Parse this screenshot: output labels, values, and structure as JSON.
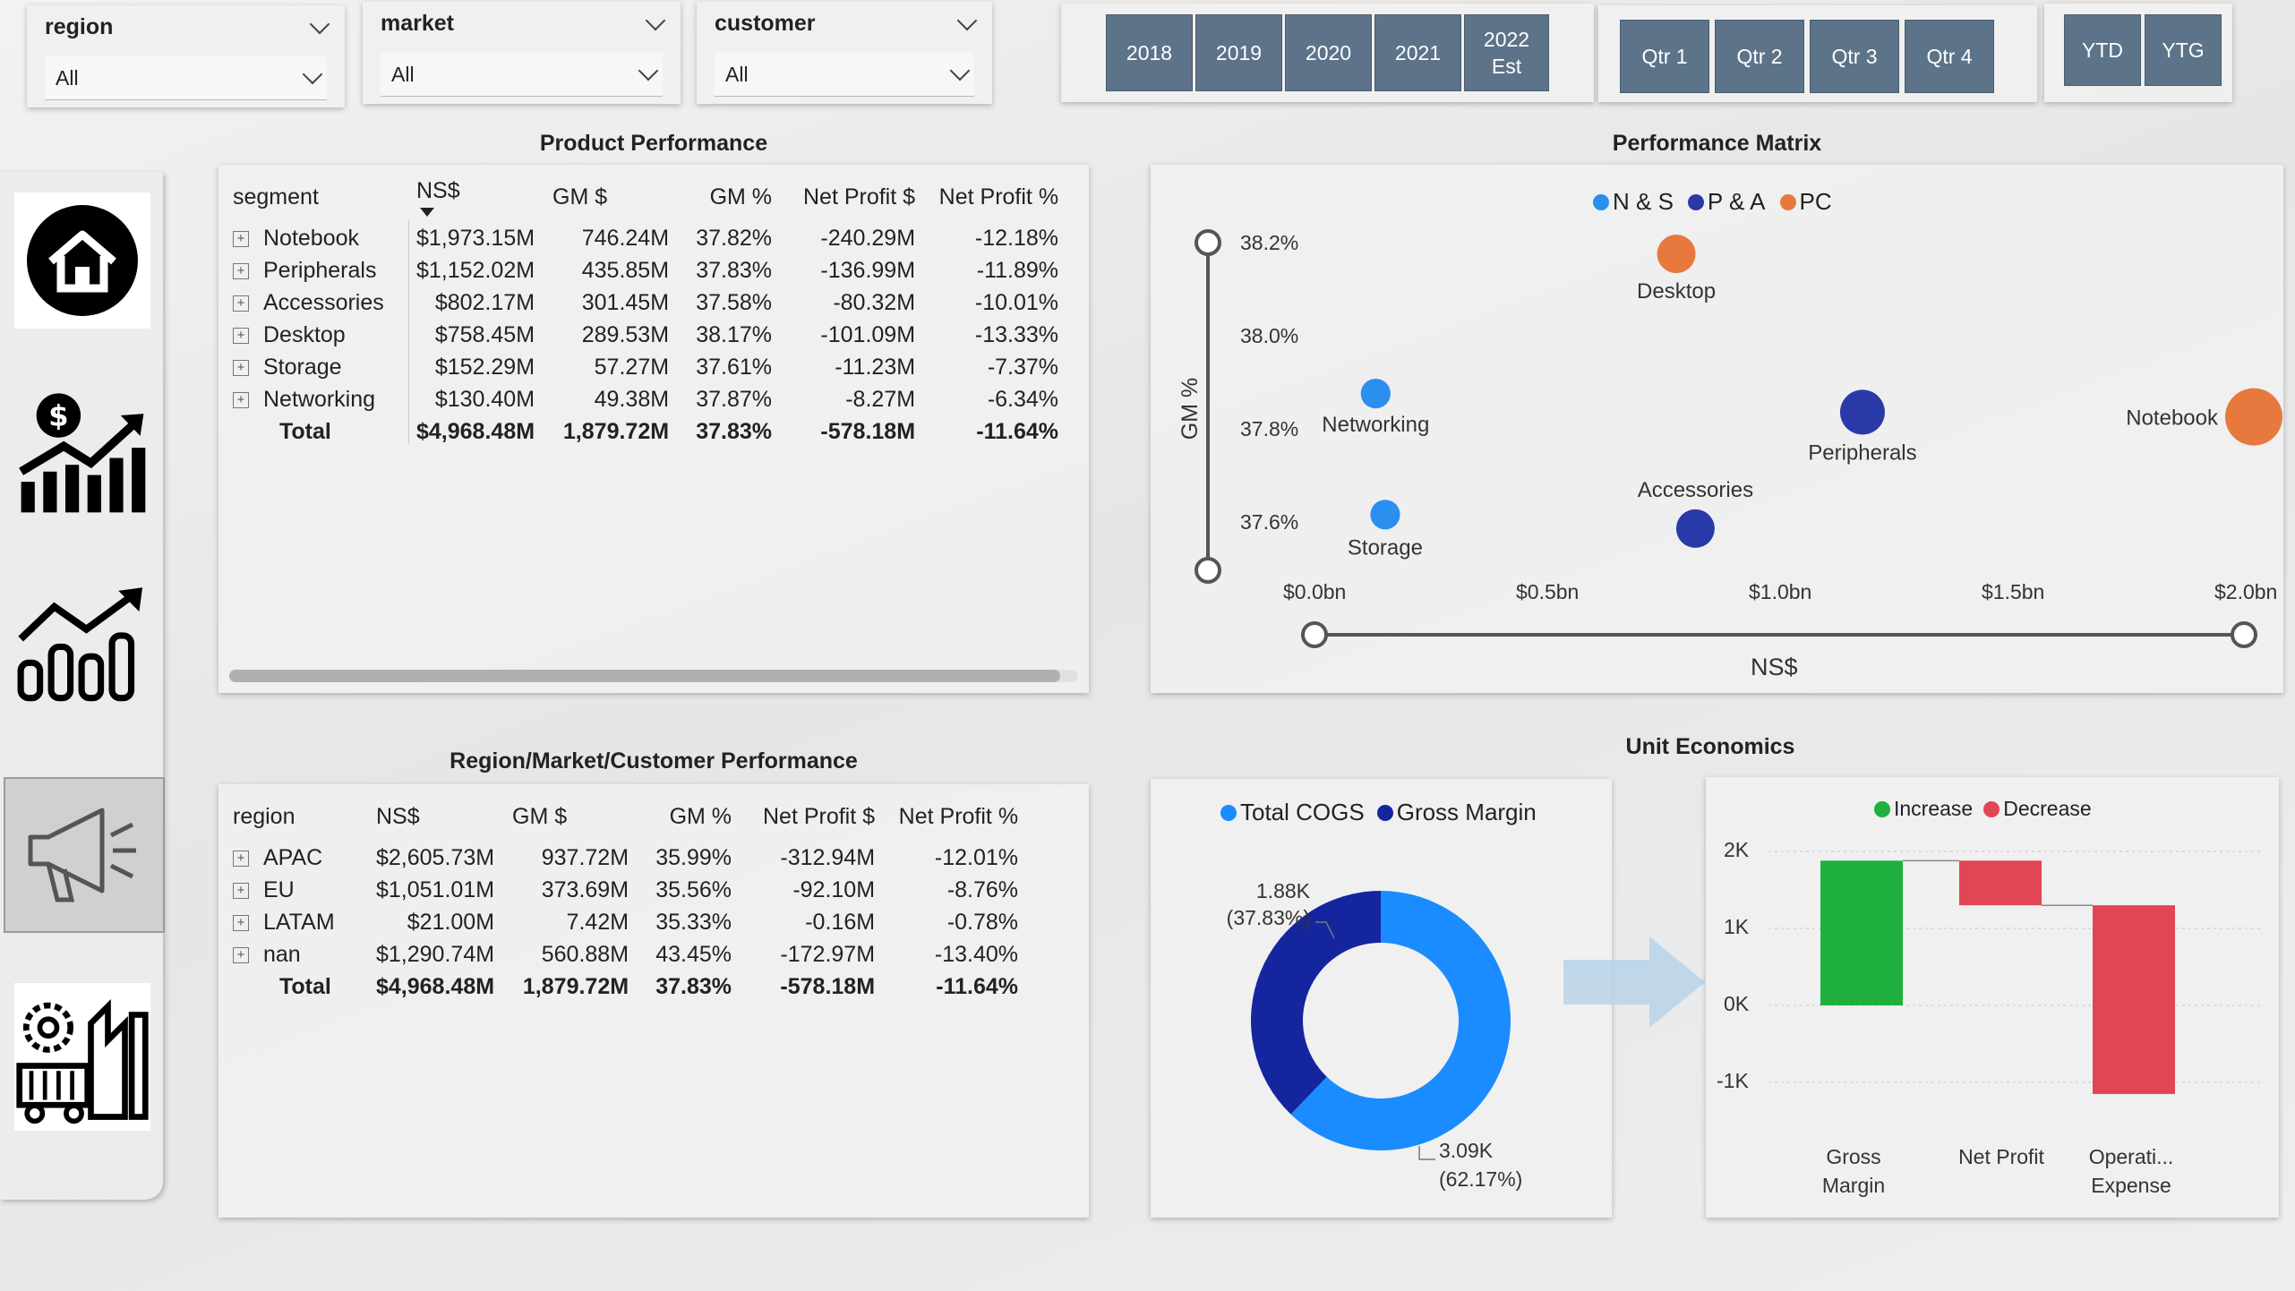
{
  "slicers": [
    {
      "label": "region",
      "value": "All"
    },
    {
      "label": "market",
      "value": "All"
    },
    {
      "label": "customer",
      "value": "All"
    }
  ],
  "years": [
    "2018",
    "2019",
    "2020",
    "2021",
    "2022 Est"
  ],
  "quarters": [
    "Qtr 1",
    "Qtr 2",
    "Qtr 3",
    "Qtr 4"
  ],
  "periods": [
    "YTD",
    "YTG"
  ],
  "nav": [
    {
      "name": "home-icon"
    },
    {
      "name": "finance-icon"
    },
    {
      "name": "growth-chart-icon"
    },
    {
      "name": "marketing-megaphone-icon"
    },
    {
      "name": "supply-chain-icon"
    }
  ],
  "product_performance": {
    "title": "Product Performance",
    "columns": [
      "segment",
      "NS$",
      "GM $",
      "GM %",
      "Net Profit $",
      "Net Profit %"
    ],
    "rows": [
      [
        "Notebook",
        "$1,973.15M",
        "746.24M",
        "37.82%",
        "-240.29M",
        "-12.18%"
      ],
      [
        "Peripherals",
        "$1,152.02M",
        "435.85M",
        "37.83%",
        "-136.99M",
        "-11.89%"
      ],
      [
        "Accessories",
        "$802.17M",
        "301.45M",
        "37.58%",
        "-80.32M",
        "-10.01%"
      ],
      [
        "Desktop",
        "$758.45M",
        "289.53M",
        "38.17%",
        "-101.09M",
        "-13.33%"
      ],
      [
        "Storage",
        "$152.29M",
        "57.27M",
        "37.61%",
        "-11.23M",
        "-7.37%"
      ],
      [
        "Networking",
        "$130.40M",
        "49.38M",
        "37.87%",
        "-8.27M",
        "-6.34%"
      ]
    ],
    "total": [
      "Total",
      "$4,968.48M",
      "1,879.72M",
      "37.83%",
      "-578.18M",
      "-11.64%"
    ]
  },
  "region_performance": {
    "title": "Region/Market/Customer Performance",
    "columns": [
      "region",
      "NS$",
      "GM $",
      "GM %",
      "Net Profit $",
      "Net Profit %"
    ],
    "rows": [
      [
        "APAC",
        "$2,605.73M",
        "937.72M",
        "35.99%",
        "-312.94M",
        "-12.01%"
      ],
      [
        "EU",
        "$1,051.01M",
        "373.69M",
        "35.56%",
        "-92.10M",
        "-8.76%"
      ],
      [
        "LATAM",
        "$21.00M",
        "7.42M",
        "35.33%",
        "-0.16M",
        "-0.78%"
      ],
      [
        "nan",
        "$1,290.74M",
        "560.88M",
        "43.45%",
        "-172.97M",
        "-13.40%"
      ]
    ],
    "total": [
      "Total",
      "$4,968.48M",
      "1,879.72M",
      "37.83%",
      "-578.18M",
      "-11.64%"
    ]
  },
  "performance_matrix": {
    "title": "Performance Matrix",
    "xlabel": "NS$",
    "ylabel": "GM %",
    "xticks": [
      "$0.0bn",
      "$0.5bn",
      "$1.0bn",
      "$1.5bn",
      "$2.0bn"
    ],
    "yticks": [
      "38.2%",
      "38.0%",
      "37.8%",
      "37.6%"
    ],
    "legend": [
      {
        "name": "N & S",
        "color": "#2b8ff0"
      },
      {
        "name": "P & A",
        "color": "#2a39a8"
      },
      {
        "name": "PC",
        "color": "#e8793e"
      }
    ]
  },
  "unit_economics": {
    "title": "Unit Economics",
    "donut_legend": [
      {
        "name": "Total COGS",
        "color": "#1a8cff"
      },
      {
        "name": "Gross Margin",
        "color": "#14259e"
      }
    ],
    "gm_label": "1.88K",
    "gm_pct": "(37.83%)",
    "cogs_label": "3.09K",
    "cogs_pct": "(62.17%)",
    "waterfall_legend": [
      {
        "name": "Increase",
        "color": "#1fb040"
      },
      {
        "name": "Decrease",
        "color": "#e04654"
      }
    ],
    "waterfall_yticks": [
      "2K",
      "1K",
      "0K",
      "-1K"
    ],
    "waterfall_categories": [
      "Gross\nMargin",
      "Net Profit",
      "Operati...\nExpense"
    ]
  },
  "chart_data": [
    {
      "type": "scatter",
      "title": "Performance Matrix",
      "xlabel": "NS$",
      "ylabel": "GM %",
      "xlim": [
        0,
        2.0
      ],
      "ylim": [
        37.5,
        38.3
      ],
      "points": [
        {
          "label": "Notebook",
          "x": 1.97,
          "y": 37.82,
          "series": "PC",
          "color": "#e8793e",
          "size": 3
        },
        {
          "label": "Peripherals",
          "x": 1.15,
          "y": 37.83,
          "series": "P & A",
          "color": "#2a39a8",
          "size": 2
        },
        {
          "label": "Accessories",
          "x": 0.8,
          "y": 37.58,
          "series": "P & A",
          "color": "#2a39a8",
          "size": 1.5
        },
        {
          "label": "Desktop",
          "x": 0.76,
          "y": 38.17,
          "series": "PC",
          "color": "#e8793e",
          "size": 1.5
        },
        {
          "label": "Storage",
          "x": 0.15,
          "y": 37.61,
          "series": "N & S",
          "color": "#2b8ff0",
          "size": 0.8
        },
        {
          "label": "Networking",
          "x": 0.13,
          "y": 37.87,
          "series": "N & S",
          "color": "#2b8ff0",
          "size": 0.8
        }
      ]
    },
    {
      "type": "pie",
      "series": [
        {
          "name": "Total COGS",
          "value": 3090,
          "percent": 62.17
        },
        {
          "name": "Gross Margin",
          "value": 1880,
          "percent": 37.83
        }
      ]
    },
    {
      "type": "bar",
      "categories": [
        "Gross Margin",
        "Net Profit",
        "Operating Expense"
      ],
      "ylim": [
        -1500,
        2500
      ],
      "bars": [
        {
          "category": "Gross Margin",
          "start": 0,
          "end": 1880,
          "kind": "Increase"
        },
        {
          "category": "Net Profit",
          "start": 1880,
          "end": 1300,
          "kind": "Decrease"
        },
        {
          "category": "Operating Expense",
          "start": 1300,
          "end": -1150,
          "kind": "Decrease"
        }
      ]
    }
  ]
}
